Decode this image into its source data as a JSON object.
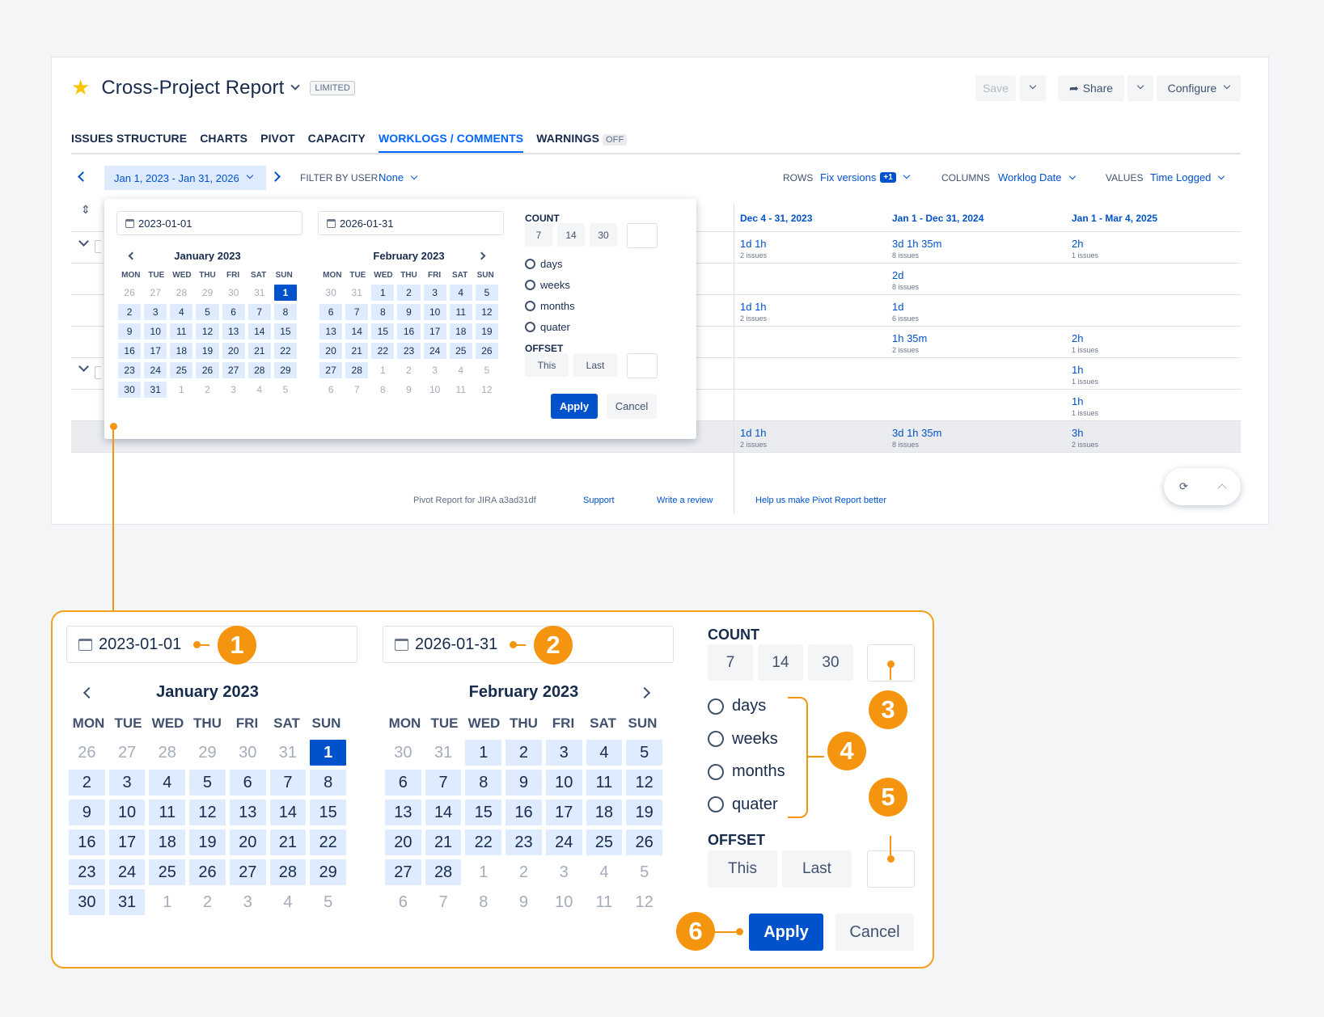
{
  "header": {
    "title": "Cross-Project Report",
    "badge": "LIMITED",
    "save": "Save",
    "share": "Share",
    "configure": "Configure"
  },
  "tabs": [
    "ISSUES STRUCTURE",
    "CHARTS",
    "PIVOT",
    "CAPACITY",
    "WORKLOGS / COMMENTS",
    "WARNINGS"
  ],
  "warnings_state": "OFF",
  "filters": {
    "date_range": "Jan 1, 2023 - Jan 31, 2026",
    "filter_by_user_label": "FILTER BY USER",
    "filter_by_user_value": "None",
    "rows_label": "ROWS",
    "rows_value": "Fix versions",
    "rows_extra": "+1",
    "columns_label": "COLUMNS",
    "columns_value": "Worklog Date",
    "values_label": "VALUES",
    "values_value": "Time Logged"
  },
  "table": {
    "columns": [
      "Dec 4 - 31, 2023",
      "Jan 1 - Dec 31, 2024",
      "Jan 1 - Mar 4, 2025"
    ],
    "rows": [
      [
        [
          "1d 1h",
          "2 issues"
        ],
        [
          "3d 1h 35m",
          "8 issues"
        ],
        [
          "2h",
          "1 issues"
        ]
      ],
      [
        null,
        [
          "2d",
          "8 issues"
        ],
        null
      ],
      [
        [
          "1d 1h",
          "2 issues"
        ],
        [
          "1d",
          "6 issues"
        ],
        null
      ],
      [
        null,
        [
          "1h 35m",
          "2 issues"
        ],
        [
          "2h",
          "1 issues"
        ]
      ],
      [
        null,
        null,
        [
          "1h",
          "1 issues"
        ]
      ],
      [
        null,
        null,
        [
          "1h",
          "1 issues"
        ]
      ],
      [
        [
          "1d 1h",
          "2 issues"
        ],
        [
          "3d 1h 35m",
          "8 issues"
        ],
        [
          "3h",
          "2 issues"
        ]
      ]
    ]
  },
  "footer": {
    "app": "Pivot Report for JIRA a3ad31df",
    "support": "Support",
    "review": "Write a review",
    "help": "Help us make Pivot Report better"
  },
  "picker": {
    "start": "2023-01-01",
    "end": "2026-01-31",
    "count_label": "COUNT",
    "count_options": [
      "7",
      "14",
      "30"
    ],
    "units": [
      "days",
      "weeks",
      "months",
      "quater"
    ],
    "offset_label": "OFFSET",
    "offset_options": [
      "This",
      "Last"
    ],
    "apply": "Apply",
    "cancel": "Cancel",
    "weekdays": [
      "MON",
      "TUE",
      "WED",
      "THU",
      "FRI",
      "SAT",
      "SUN"
    ],
    "months": [
      {
        "title": "January 2023",
        "days": [
          "26",
          "27",
          "28",
          "29",
          "30",
          "31",
          "1",
          "2",
          "3",
          "4",
          "5",
          "6",
          "7",
          "8",
          "9",
          "10",
          "11",
          "12",
          "13",
          "14",
          "15",
          "16",
          "17",
          "18",
          "19",
          "20",
          "21",
          "22",
          "23",
          "24",
          "25",
          "26",
          "27",
          "28",
          "29",
          "30",
          "31",
          "1",
          "2",
          "3",
          "4",
          "5"
        ],
        "in_month_from": 6,
        "in_month_to": 36,
        "selected": 6
      },
      {
        "title": "February 2023",
        "days": [
          "30",
          "31",
          "1",
          "2",
          "3",
          "4",
          "5",
          "6",
          "7",
          "8",
          "9",
          "10",
          "11",
          "12",
          "13",
          "14",
          "15",
          "16",
          "17",
          "18",
          "19",
          "20",
          "21",
          "22",
          "23",
          "24",
          "25",
          "26",
          "27",
          "28",
          "1",
          "2",
          "3",
          "4",
          "5",
          "6",
          "7",
          "8",
          "9",
          "10",
          "11",
          "12"
        ],
        "in_month_from": 2,
        "in_month_to": 29,
        "selected": -1
      }
    ]
  },
  "callouts": [
    "1",
    "2",
    "3",
    "4",
    "5",
    "6"
  ]
}
